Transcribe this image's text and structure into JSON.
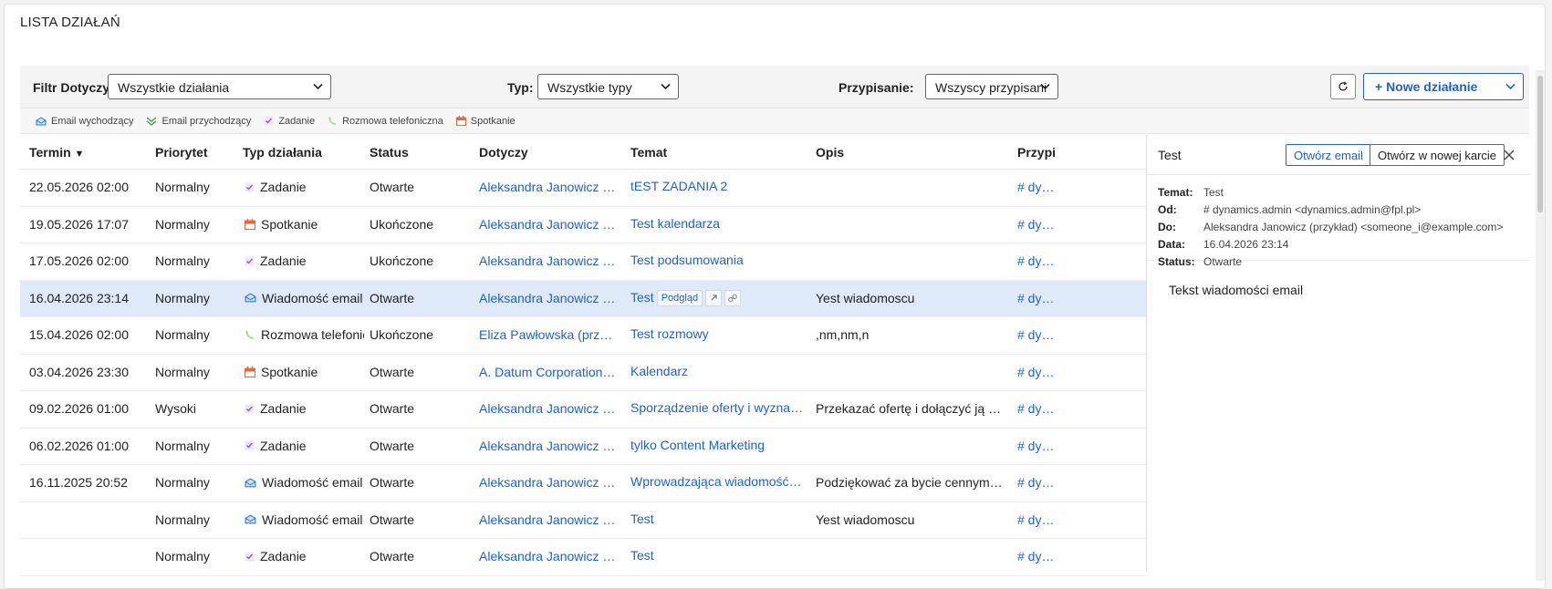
{
  "page": {
    "title": "LISTA DZIAŁAŃ"
  },
  "filters": {
    "related_label": "Filtr Dotyczy:",
    "related_value": "Wszystkie działania",
    "type_label": "Typ:",
    "type_value": "Wszystkie typy",
    "assigned_label": "Przypisanie:",
    "assigned_value": "Wszyscy przypisani",
    "new_button": "+ Nowe działanie",
    "refresh_icon": "refresh-icon"
  },
  "legend": [
    {
      "label": "Email wychodzący",
      "icon": "outgoing-email-icon"
    },
    {
      "label": "Email przychodzący",
      "icon": "incoming-email-icon"
    },
    {
      "label": "Zadanie",
      "icon": "task-icon"
    },
    {
      "label": "Rozmowa telefoniczna",
      "icon": "phone-icon"
    },
    {
      "label": "Spotkanie",
      "icon": "meeting-icon"
    }
  ],
  "table": {
    "columns": {
      "termin": "Termin",
      "sort_indicator": "▼",
      "priorytet": "Priorytet",
      "typ": "Typ działania",
      "status": "Status",
      "dotyczy": "Dotyczy",
      "temat": "Temat",
      "opis": "Opis",
      "przypis": "Przypis"
    },
    "rows": [
      {
        "termin": "22.05.2026 02:00",
        "priorytet": "Normalny",
        "typ": "Zadanie",
        "icon": "task",
        "status": "Otwarte",
        "dotyczy": "Aleksandra Janowicz (pr...",
        "temat": "tEST ZADANIA 2",
        "opis": "",
        "przypis": "# dynam"
      },
      {
        "termin": "19.05.2026 17:07",
        "priorytet": "Normalny",
        "typ": "Spotkanie",
        "icon": "meeting",
        "status": "Ukończone",
        "dotyczy": "Aleksandra Janowicz (pr...",
        "temat": "Test kalendarza",
        "opis": "",
        "przypis": "# dynam"
      },
      {
        "termin": "17.05.2026 02:00",
        "priorytet": "Normalny",
        "typ": "Zadanie",
        "icon": "task",
        "status": "Ukończone",
        "dotyczy": "Aleksandra Janowicz (pr...",
        "temat": "Test podsumowania",
        "opis": "",
        "przypis": "# dynam"
      },
      {
        "termin": "16.04.2026 23:14",
        "priorytet": "Normalny",
        "typ": "Wiadomość email",
        "icon": "email",
        "status": "Otwarte",
        "dotyczy": "Aleksandra Janowicz (pr...",
        "temat": "Test",
        "opis": "Yest wiadomoscu",
        "przypis": "# dynam",
        "selected": true,
        "preview_label": "Podgląd"
      },
      {
        "termin": "15.04.2026 02:00",
        "priorytet": "Normalny",
        "typ": "Rozmowa telefoniczna",
        "icon": "phone",
        "status": "Ukończone",
        "dotyczy": "Eliza Pawłowska (przykł...",
        "temat": "Test rozmowy",
        "opis": ",nm,nm,n",
        "przypis": "# dynam"
      },
      {
        "termin": "03.04.2026 23:30",
        "priorytet": "Normalny",
        "typ": "Spotkanie",
        "icon": "meeting",
        "status": "Otwarte",
        "dotyczy": "A. Datum Corporation (...",
        "temat": "Kalendarz",
        "opis": "",
        "przypis": "# dynam"
      },
      {
        "termin": "09.02.2026 01:00",
        "priorytet": "Wysoki",
        "typ": "Zadanie",
        "icon": "task",
        "status": "Otwarte",
        "dotyczy": "Aleksandra Janowicz (pr...",
        "temat": "Sporządzenie oferty i wyznacz...",
        "opis": "Przekazać ofertę i dołączyć ją do r...",
        "przypis": "# dynam"
      },
      {
        "termin": "06.02.2026 01:00",
        "priorytet": "Normalny",
        "typ": "Zadanie",
        "icon": "task",
        "status": "Otwarte",
        "dotyczy": "Aleksandra Janowicz (pr...",
        "temat": "tylko Content Marketing",
        "opis": "",
        "przypis": "# dynam"
      },
      {
        "termin": "16.11.2025 20:52",
        "priorytet": "Normalny",
        "typ": "Wiadomość email",
        "icon": "email",
        "status": "Otwarte",
        "dotyczy": "Aleksandra Janowicz (pr...",
        "temat": "Wprowadzająca wiadomość e-...",
        "opis": "Podziękować za bycie cennym kli...",
        "przypis": "# dynam"
      },
      {
        "termin": "",
        "priorytet": "Normalny",
        "typ": "Wiadomość email",
        "icon": "email",
        "status": "Otwarte",
        "dotyczy": "Aleksandra Janowicz (pr...",
        "temat": "Test",
        "opis": "Yest wiadomoscu",
        "przypis": "# dynam"
      },
      {
        "termin": "",
        "priorytet": "Normalny",
        "typ": "Zadanie",
        "icon": "task",
        "status": "Otwarte",
        "dotyczy": "Aleksandra Janowicz (pr...",
        "temat": "Test",
        "opis": "",
        "przypis": "# dynam"
      }
    ]
  },
  "preview": {
    "title": "Test",
    "open_email": "Otwórz email",
    "open_new_tab": "Otwórz w nowej karcie",
    "fields": [
      {
        "key": "Temat:",
        "value": "Test"
      },
      {
        "key": "Od:",
        "value": "# dynamics.admin <dynamics.admin@fpl.pl>"
      },
      {
        "key": "Do:",
        "value": "Aleksandra Janowicz (przykład) <someone_i@example.com>"
      },
      {
        "key": "Data:",
        "value": "16.04.2026 23:14"
      },
      {
        "key": "Status:",
        "value": "Otwarte"
      }
    ],
    "body": "Tekst wiadomości email"
  },
  "colors": {
    "accent": "#1e62c9",
    "selected_row": "#dfeaf9",
    "meeting": "#e8663d",
    "task": "#8a5cc2",
    "phone": "#7bbf7b"
  }
}
